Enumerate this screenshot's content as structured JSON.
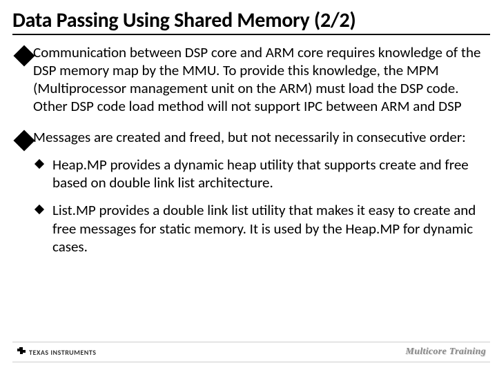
{
  "title": "Data Passing Using Shared Memory (2/2)",
  "bullets": [
    {
      "text": "Communication between DSP core and ARM core requires knowledge of the DSP memory map by the MMU. To provide this knowledge, the MPM (Multiprocessor management unit on the ARM) must load the DSP code. Other DSP code load method will not support IPC between ARM and DSP"
    },
    {
      "text": "Messages are created and freed, but not necessarily in consecutive order:",
      "sub": [
        "Heap.MP provides a dynamic heap utility that supports create and free based on double link list architecture.",
        "List.MP provides a double link list utility that makes it easy to create and free messages for static memory. It is used by the Heap.MP for dynamic cases."
      ]
    }
  ],
  "footer": {
    "logo_text": "TEXAS INSTRUMENTS",
    "brand": "Multicore Training"
  }
}
